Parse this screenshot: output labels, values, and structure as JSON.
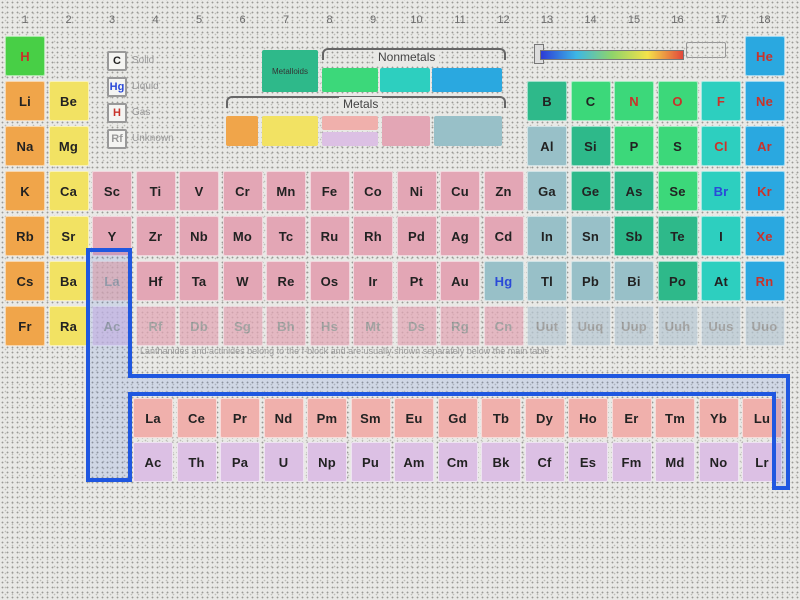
{
  "groups": [
    "1",
    "2",
    "3",
    "4",
    "5",
    "6",
    "7",
    "8",
    "9",
    "10",
    "11",
    "12",
    "13",
    "14",
    "15",
    "16",
    "17",
    "18"
  ],
  "legend": {
    "keys": [
      {
        "symbol": "C",
        "color": "#222222",
        "label": "Solid"
      },
      {
        "symbol": "Hg",
        "color": "#2a49d8",
        "label": "Liquid"
      },
      {
        "symbol": "H",
        "color": "#c8332b",
        "label": "Gas"
      },
      {
        "symbol": "Rf",
        "color": "#9a9a9a",
        "label": "Unknown"
      }
    ],
    "metalloids_label": "Metalloids",
    "nonmetals_title": "Nonmetals",
    "metals_title": "Metals",
    "note_text": "Lanthanides and actinides belong to the f-block and are usually shown separately below the main table"
  },
  "colors": {
    "alkali": "#f0a54a",
    "alkaline": "#f2e263",
    "transition": "#e3a6b5",
    "post": "#98c0c8",
    "metalloid": "#2eb98a",
    "nonmetal": "#3cd87a",
    "halogen": "#2dcfbf",
    "noble": "#2aa8e0",
    "lanth": "#f0b0ac",
    "actin": "#dcc0e4",
    "hydrogen": "#48cf46",
    "unknown": "#b8c9d3"
  },
  "elements": [
    {
      "s": "H",
      "c": "hydrogen",
      "st": "gas"
    },
    {
      "s": "He",
      "c": "noble",
      "st": "gas"
    },
    {
      "s": "Li",
      "c": "alkali",
      "st": "solid"
    },
    {
      "s": "Be",
      "c": "alkaline",
      "st": "solid"
    },
    {
      "s": "B",
      "c": "metalloid",
      "st": "solid"
    },
    {
      "s": "C",
      "c": "nonmetal",
      "st": "solid"
    },
    {
      "s": "N",
      "c": "nonmetal",
      "st": "gas"
    },
    {
      "s": "O",
      "c": "nonmetal",
      "st": "gas"
    },
    {
      "s": "F",
      "c": "halogen",
      "st": "gas"
    },
    {
      "s": "Ne",
      "c": "noble",
      "st": "gas"
    },
    {
      "s": "Na",
      "c": "alkali",
      "st": "solid"
    },
    {
      "s": "Mg",
      "c": "alkaline",
      "st": "solid"
    },
    {
      "s": "Al",
      "c": "post",
      "st": "solid"
    },
    {
      "s": "Si",
      "c": "metalloid",
      "st": "solid"
    },
    {
      "s": "P",
      "c": "nonmetal",
      "st": "solid"
    },
    {
      "s": "S",
      "c": "nonmetal",
      "st": "solid"
    },
    {
      "s": "Cl",
      "c": "halogen",
      "st": "gas"
    },
    {
      "s": "Ar",
      "c": "noble",
      "st": "gas"
    },
    {
      "s": "K",
      "c": "alkali",
      "st": "solid"
    },
    {
      "s": "Ca",
      "c": "alkaline",
      "st": "solid"
    },
    {
      "s": "Sc",
      "c": "transition",
      "st": "solid"
    },
    {
      "s": "Ti",
      "c": "transition",
      "st": "solid"
    },
    {
      "s": "V",
      "c": "transition",
      "st": "solid"
    },
    {
      "s": "Cr",
      "c": "transition",
      "st": "solid"
    },
    {
      "s": "Mn",
      "c": "transition",
      "st": "solid"
    },
    {
      "s": "Fe",
      "c": "transition",
      "st": "solid"
    },
    {
      "s": "Co",
      "c": "transition",
      "st": "solid"
    },
    {
      "s": "Ni",
      "c": "transition",
      "st": "solid"
    },
    {
      "s": "Cu",
      "c": "transition",
      "st": "solid"
    },
    {
      "s": "Zn",
      "c": "transition",
      "st": "solid"
    },
    {
      "s": "Ga",
      "c": "post",
      "st": "solid"
    },
    {
      "s": "Ge",
      "c": "metalloid",
      "st": "solid"
    },
    {
      "s": "As",
      "c": "metalloid",
      "st": "solid"
    },
    {
      "s": "Se",
      "c": "nonmetal",
      "st": "solid"
    },
    {
      "s": "Br",
      "c": "halogen",
      "st": "liquid"
    },
    {
      "s": "Kr",
      "c": "noble",
      "st": "gas"
    },
    {
      "s": "Rb",
      "c": "alkali",
      "st": "solid"
    },
    {
      "s": "Sr",
      "c": "alkaline",
      "st": "solid"
    },
    {
      "s": "Y",
      "c": "transition",
      "st": "solid"
    },
    {
      "s": "Zr",
      "c": "transition",
      "st": "solid"
    },
    {
      "s": "Nb",
      "c": "transition",
      "st": "solid"
    },
    {
      "s": "Mo",
      "c": "transition",
      "st": "solid"
    },
    {
      "s": "Tc",
      "c": "transition",
      "st": "solid"
    },
    {
      "s": "Ru",
      "c": "transition",
      "st": "solid"
    },
    {
      "s": "Rh",
      "c": "transition",
      "st": "solid"
    },
    {
      "s": "Pd",
      "c": "transition",
      "st": "solid"
    },
    {
      "s": "Ag",
      "c": "transition",
      "st": "solid"
    },
    {
      "s": "Cd",
      "c": "transition",
      "st": "solid"
    },
    {
      "s": "In",
      "c": "post",
      "st": "solid"
    },
    {
      "s": "Sn",
      "c": "post",
      "st": "solid"
    },
    {
      "s": "Sb",
      "c": "metalloid",
      "st": "solid"
    },
    {
      "s": "Te",
      "c": "metalloid",
      "st": "solid"
    },
    {
      "s": "I",
      "c": "halogen",
      "st": "solid"
    },
    {
      "s": "Xe",
      "c": "noble",
      "st": "gas"
    },
    {
      "s": "Cs",
      "c": "alkali",
      "st": "solid"
    },
    {
      "s": "Ba",
      "c": "alkaline",
      "st": "solid"
    },
    {
      "s": "La",
      "c": "lanth",
      "st": "solid",
      "faded": true
    },
    {
      "s": "Hf",
      "c": "transition",
      "st": "solid"
    },
    {
      "s": "Ta",
      "c": "transition",
      "st": "solid"
    },
    {
      "s": "W",
      "c": "transition",
      "st": "solid"
    },
    {
      "s": "Re",
      "c": "transition",
      "st": "solid"
    },
    {
      "s": "Os",
      "c": "transition",
      "st": "solid"
    },
    {
      "s": "Ir",
      "c": "transition",
      "st": "solid"
    },
    {
      "s": "Pt",
      "c": "transition",
      "st": "solid"
    },
    {
      "s": "Au",
      "c": "transition",
      "st": "solid"
    },
    {
      "s": "Hg",
      "c": "post",
      "st": "liquid"
    },
    {
      "s": "Tl",
      "c": "post",
      "st": "solid"
    },
    {
      "s": "Pb",
      "c": "post",
      "st": "solid"
    },
    {
      "s": "Bi",
      "c": "post",
      "st": "solid"
    },
    {
      "s": "Po",
      "c": "metalloid",
      "st": "solid"
    },
    {
      "s": "At",
      "c": "halogen",
      "st": "solid"
    },
    {
      "s": "Rn",
      "c": "noble",
      "st": "gas"
    },
    {
      "s": "Fr",
      "c": "alkali",
      "st": "solid"
    },
    {
      "s": "Ra",
      "c": "alkaline",
      "st": "solid"
    },
    {
      "s": "Ac",
      "c": "actin",
      "st": "solid",
      "faded": true
    },
    {
      "s": "Rf",
      "c": "transition",
      "st": "unknown",
      "faded": true
    },
    {
      "s": "Db",
      "c": "transition",
      "st": "unknown",
      "faded": true
    },
    {
      "s": "Sg",
      "c": "transition",
      "st": "unknown",
      "faded": true
    },
    {
      "s": "Bh",
      "c": "transition",
      "st": "unknown",
      "faded": true
    },
    {
      "s": "Hs",
      "c": "transition",
      "st": "unknown",
      "faded": true
    },
    {
      "s": "Mt",
      "c": "transition",
      "st": "unknown",
      "faded": true
    },
    {
      "s": "Ds",
      "c": "transition",
      "st": "unknown",
      "faded": true
    },
    {
      "s": "Rg",
      "c": "transition",
      "st": "unknown",
      "faded": true
    },
    {
      "s": "Cn",
      "c": "transition",
      "st": "unknown",
      "faded": true
    },
    {
      "s": "Uut",
      "c": "unknown",
      "st": "unknown",
      "faded": true
    },
    {
      "s": "Uuq",
      "c": "unknown",
      "st": "unknown",
      "faded": true
    },
    {
      "s": "Uup",
      "c": "unknown",
      "st": "unknown",
      "faded": true
    },
    {
      "s": "Uuh",
      "c": "unknown",
      "st": "unknown",
      "faded": true
    },
    {
      "s": "Uus",
      "c": "unknown",
      "st": "unknown",
      "faded": true
    },
    {
      "s": "Uuo",
      "c": "unknown",
      "st": "unknown",
      "faded": true
    }
  ],
  "lanthanides": [
    "La",
    "Ce",
    "Pr",
    "Nd",
    "Pm",
    "Sm",
    "Eu",
    "Gd",
    "Tb",
    "Dy",
    "Ho",
    "Er",
    "Tm",
    "Yb",
    "Lu"
  ],
  "actinides": [
    "Ac",
    "Th",
    "Pa",
    "U",
    "Np",
    "Pu",
    "Am",
    "Cm",
    "Bk",
    "Cf",
    "Es",
    "Fm",
    "Md",
    "No",
    "Lr"
  ],
  "highlight_color": "#1f57e0"
}
